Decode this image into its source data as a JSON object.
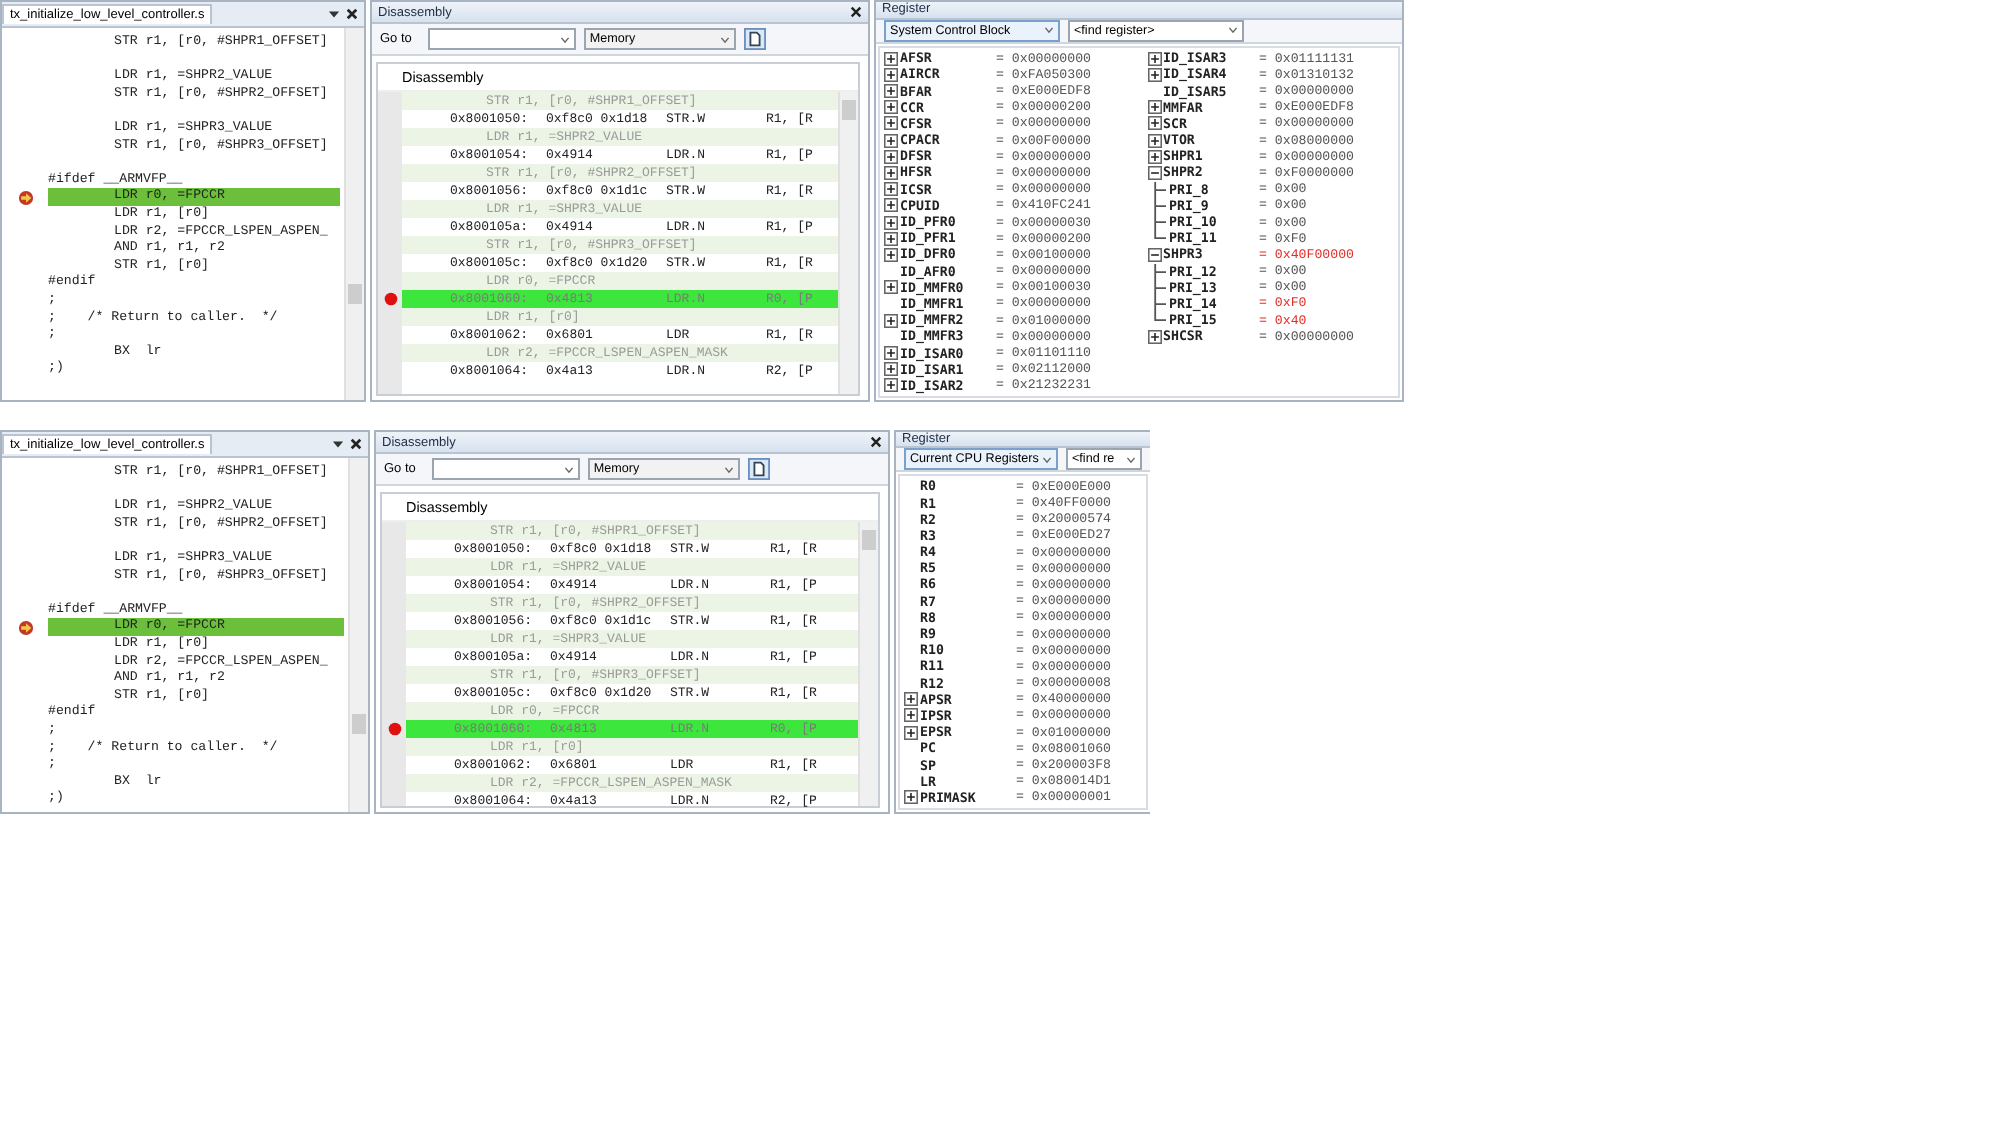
{
  "snapshots": [
    {
      "editor": {
        "tab": "tx_initialize_low_level_controller.s",
        "lines": [
          {
            "kind": "code",
            "indent": true,
            "text": "STR r1, [r0, #SHPR1_OFFSET]",
            "current": false
          },
          {
            "kind": "blank"
          },
          {
            "kind": "code",
            "indent": true,
            "text": "LDR r1, =SHPR2_VALUE",
            "current": false
          },
          {
            "kind": "code",
            "indent": true,
            "text": "STR r1, [r0, #SHPR2_OFFSET]",
            "current": false
          },
          {
            "kind": "blank"
          },
          {
            "kind": "code",
            "indent": true,
            "text": "LDR r1, =SHPR3_VALUE",
            "current": false
          },
          {
            "kind": "code",
            "indent": true,
            "text": "STR r1, [r0, #SHPR3_OFFSET]",
            "current": false
          },
          {
            "kind": "blank"
          },
          {
            "kind": "code",
            "indent": false,
            "text": "#ifdef __ARMVFP__",
            "current": false
          },
          {
            "kind": "code",
            "indent": true,
            "text": "LDR r0, =FPCCR",
            "current": true
          },
          {
            "kind": "code",
            "indent": true,
            "text": "LDR r1, [r0]",
            "current": false
          },
          {
            "kind": "code",
            "indent": true,
            "text": "LDR r2, =FPCCR_LSPEN_ASPEN_",
            "current": false
          },
          {
            "kind": "code",
            "indent": true,
            "text": "AND r1, r1, r2",
            "current": false
          },
          {
            "kind": "code",
            "indent": true,
            "text": "STR r1, [r0]",
            "current": false
          },
          {
            "kind": "code",
            "indent": false,
            "text": "#endif",
            "current": false
          },
          {
            "kind": "code",
            "indent": false,
            "text": ";",
            "current": false
          },
          {
            "kind": "code",
            "indent": false,
            "text": ";    /* Return to caller.  */",
            "current": false
          },
          {
            "kind": "code",
            "indent": false,
            "text": ";",
            "current": false
          },
          {
            "kind": "code",
            "indent": true,
            "text": "BX  lr",
            "current": false
          },
          {
            "kind": "code",
            "indent": false,
            "text": ";)",
            "current": false
          }
        ]
      },
      "disassembly": {
        "title": "Disassembly",
        "goto_label": "Go to",
        "memory": "Memory",
        "header": "Disassembly",
        "rows": [
          {
            "kind": "source",
            "text": "STR r1, [r0, #SHPR1_OFFSET]"
          },
          {
            "kind": "instr",
            "address": "0x8001050:",
            "opcode": "0xf8c0 0x1d18",
            "mnemonic": "STR.W",
            "operand": "R1, [R",
            "breakpoint": false,
            "current": false
          },
          {
            "kind": "source",
            "text": "LDR r1, =SHPR2_VALUE"
          },
          {
            "kind": "instr",
            "address": "0x8001054:",
            "opcode": "0x4914",
            "mnemonic": "LDR.N",
            "operand": "R1, [P",
            "breakpoint": false,
            "current": false
          },
          {
            "kind": "source",
            "text": "STR r1, [r0, #SHPR2_OFFSET]"
          },
          {
            "kind": "instr",
            "address": "0x8001056:",
            "opcode": "0xf8c0 0x1d1c",
            "mnemonic": "STR.W",
            "operand": "R1, [R",
            "breakpoint": false,
            "current": false
          },
          {
            "kind": "source",
            "text": "LDR r1, =SHPR3_VALUE"
          },
          {
            "kind": "instr",
            "address": "0x800105a:",
            "opcode": "0x4914",
            "mnemonic": "LDR.N",
            "operand": "R1, [P",
            "breakpoint": false,
            "current": false
          },
          {
            "kind": "source",
            "text": "STR r1, [r0, #SHPR3_OFFSET]"
          },
          {
            "kind": "instr",
            "address": "0x800105c:",
            "opcode": "0xf8c0 0x1d20",
            "mnemonic": "STR.W",
            "operand": "R1, [R",
            "breakpoint": false,
            "current": false
          },
          {
            "kind": "source",
            "text": "LDR r0, =FPCCR"
          },
          {
            "kind": "instr",
            "address": "0x8001060:",
            "opcode": "0x4813",
            "mnemonic": "LDR.N",
            "operand": "R0, [P",
            "breakpoint": true,
            "current": true
          },
          {
            "kind": "source",
            "text": "LDR r1, [r0]"
          },
          {
            "kind": "instr",
            "address": "0x8001062:",
            "opcode": "0x6801",
            "mnemonic": "LDR",
            "operand": "R1, [R",
            "breakpoint": false,
            "current": false
          },
          {
            "kind": "source",
            "text": "LDR r2, =FPCCR_LSPEN_ASPEN_MASK"
          },
          {
            "kind": "instr",
            "address": "0x8001064:",
            "opcode": "0x4a13",
            "mnemonic": "LDR.N",
            "operand": "R2, [P",
            "breakpoint": false,
            "current": false
          }
        ]
      },
      "register": {
        "title": "Register",
        "group": "System Control Block",
        "find": "<find register>",
        "columns": [
          {
            "registers": [
              {
                "name": "AFSR",
                "value": "= 0x00000000",
                "expandable": true,
                "expanded": false,
                "changed": false
              },
              {
                "name": "AIRCR",
                "value": "= 0xFA050300",
                "expandable": true,
                "expanded": false,
                "changed": false
              },
              {
                "name": "BFAR",
                "value": "= 0xE000EDF8",
                "expandable": true,
                "expanded": false,
                "changed": false
              },
              {
                "name": "CCR",
                "value": "= 0x00000200",
                "expandable": true,
                "expanded": false,
                "changed": false
              },
              {
                "name": "CFSR",
                "value": "= 0x00000000",
                "expandable": true,
                "expanded": false,
                "changed": false
              },
              {
                "name": "CPACR",
                "value": "= 0x00F00000",
                "expandable": true,
                "expanded": false,
                "changed": false
              },
              {
                "name": "DFSR",
                "value": "= 0x00000000",
                "expandable": true,
                "expanded": false,
                "changed": false
              },
              {
                "name": "HFSR",
                "value": "= 0x00000000",
                "expandable": true,
                "expanded": false,
                "changed": false
              },
              {
                "name": "ICSR",
                "value": "= 0x00000000",
                "expandable": true,
                "expanded": false,
                "changed": false
              },
              {
                "name": "CPUID",
                "value": "= 0x410FC241",
                "expandable": true,
                "expanded": false,
                "changed": false
              },
              {
                "name": "ID_PFR0",
                "value": "= 0x00000030",
                "expandable": true,
                "expanded": false,
                "changed": false
              },
              {
                "name": "ID_PFR1",
                "value": "= 0x00000200",
                "expandable": true,
                "expanded": false,
                "changed": false
              },
              {
                "name": "ID_DFR0",
                "value": "= 0x00100000",
                "expandable": true,
                "expanded": false,
                "changed": false
              },
              {
                "name": "ID_AFR0",
                "value": "= 0x00000000",
                "expandable": false,
                "changed": false
              },
              {
                "name": "ID_MMFR0",
                "value": "= 0x00100030",
                "expandable": true,
                "expanded": false,
                "changed": false
              },
              {
                "name": "ID_MMFR1",
                "value": "= 0x00000000",
                "expandable": false,
                "changed": false
              },
              {
                "name": "ID_MMFR2",
                "value": "= 0x01000000",
                "expandable": true,
                "expanded": false,
                "changed": false
              },
              {
                "name": "ID_MMFR3",
                "value": "= 0x00000000",
                "expandable": false,
                "changed": false
              },
              {
                "name": "ID_ISAR0",
                "value": "= 0x01101110",
                "expandable": true,
                "expanded": false,
                "changed": false
              },
              {
                "name": "ID_ISAR1",
                "value": "= 0x02112000",
                "expandable": true,
                "expanded": false,
                "changed": false
              },
              {
                "name": "ID_ISAR2",
                "value": "= 0x21232231",
                "expandable": true,
                "expanded": false,
                "changed": false
              }
            ]
          },
          {
            "registers": [
              {
                "name": "ID_ISAR3",
                "value": "= 0x01111131",
                "expandable": true,
                "expanded": false,
                "changed": false
              },
              {
                "name": "ID_ISAR4",
                "value": "= 0x01310132",
                "expandable": true,
                "expanded": false,
                "changed": false
              },
              {
                "name": "ID_ISAR5",
                "value": "= 0x00000000",
                "expandable": false,
                "changed": false
              },
              {
                "name": "MMFAR",
                "value": "= 0xE000EDF8",
                "expandable": true,
                "expanded": false,
                "changed": false
              },
              {
                "name": "SCR",
                "value": "= 0x00000000",
                "expandable": true,
                "expanded": false,
                "changed": false
              },
              {
                "name": "VTOR",
                "value": "= 0x08000000",
                "expandable": true,
                "expanded": false,
                "changed": false
              },
              {
                "name": "SHPR1",
                "value": "= 0x00000000",
                "expandable": true,
                "expanded": false,
                "changed": false
              },
              {
                "name": "SHPR2",
                "value": "= 0xF0000000",
                "expandable": true,
                "expanded": true,
                "changed": false,
                "children": [
                  {
                    "name": "PRI_8",
                    "value": "= 0x00",
                    "changed": false
                  },
                  {
                    "name": "PRI_9",
                    "value": "= 0x00",
                    "changed": false
                  },
                  {
                    "name": "PRI_10",
                    "value": "= 0x00",
                    "changed": false
                  },
                  {
                    "name": "PRI_11",
                    "value": "= 0xF0",
                    "changed": false
                  }
                ]
              },
              {
                "name": "SHPR3",
                "value": "= 0x40F00000",
                "expandable": true,
                "expanded": true,
                "changed": true,
                "children": [
                  {
                    "name": "PRI_12",
                    "value": "= 0x00",
                    "changed": false
                  },
                  {
                    "name": "PRI_13",
                    "value": "= 0x00",
                    "changed": false
                  },
                  {
                    "name": "PRI_14",
                    "value": "= 0xF0",
                    "changed": true
                  },
                  {
                    "name": "PRI_15",
                    "value": "= 0x40",
                    "changed": true
                  }
                ]
              },
              {
                "name": "SHCSR",
                "value": "= 0x00000000",
                "expandable": true,
                "expanded": false,
                "changed": false
              }
            ]
          }
        ]
      }
    },
    {
      "editor": {
        "tab": "tx_initialize_low_level_controller.s",
        "lines": [
          {
            "kind": "code",
            "indent": true,
            "text": "STR r1, [r0, #SHPR1_OFFSET]",
            "current": false
          },
          {
            "kind": "blank"
          },
          {
            "kind": "code",
            "indent": true,
            "text": "LDR r1, =SHPR2_VALUE",
            "current": false
          },
          {
            "kind": "code",
            "indent": true,
            "text": "STR r1, [r0, #SHPR2_OFFSET]",
            "current": false
          },
          {
            "kind": "blank"
          },
          {
            "kind": "code",
            "indent": true,
            "text": "LDR r1, =SHPR3_VALUE",
            "current": false
          },
          {
            "kind": "code",
            "indent": true,
            "text": "STR r1, [r0, #SHPR3_OFFSET]",
            "current": false
          },
          {
            "kind": "blank"
          },
          {
            "kind": "code",
            "indent": false,
            "text": "#ifdef __ARMVFP__",
            "current": false
          },
          {
            "kind": "code",
            "indent": true,
            "text": "LDR r0, =FPCCR",
            "current": true
          },
          {
            "kind": "code",
            "indent": true,
            "text": "LDR r1, [r0]",
            "current": false
          },
          {
            "kind": "code",
            "indent": true,
            "text": "LDR r2, =FPCCR_LSPEN_ASPEN_",
            "current": false
          },
          {
            "kind": "code",
            "indent": true,
            "text": "AND r1, r1, r2",
            "current": false
          },
          {
            "kind": "code",
            "indent": true,
            "text": "STR r1, [r0]",
            "current": false
          },
          {
            "kind": "code",
            "indent": false,
            "text": "#endif",
            "current": false
          },
          {
            "kind": "code",
            "indent": false,
            "text": ";",
            "current": false
          },
          {
            "kind": "code",
            "indent": false,
            "text": ";    /* Return to caller.  */",
            "current": false
          },
          {
            "kind": "code",
            "indent": false,
            "text": ";",
            "current": false
          },
          {
            "kind": "code",
            "indent": true,
            "text": "BX  lr",
            "current": false
          },
          {
            "kind": "code",
            "indent": false,
            "text": ";)",
            "current": false
          }
        ]
      },
      "disassembly": {
        "title": "Disassembly",
        "goto_label": "Go to",
        "memory": "Memory",
        "header": "Disassembly",
        "rows": [
          {
            "kind": "source",
            "text": "STR r1, [r0, #SHPR1_OFFSET]"
          },
          {
            "kind": "instr",
            "address": "0x8001050:",
            "opcode": "0xf8c0 0x1d18",
            "mnemonic": "STR.W",
            "operand": "R1, [R",
            "breakpoint": false,
            "current": false
          },
          {
            "kind": "source",
            "text": "LDR r1, =SHPR2_VALUE"
          },
          {
            "kind": "instr",
            "address": "0x8001054:",
            "opcode": "0x4914",
            "mnemonic": "LDR.N",
            "operand": "R1, [P",
            "breakpoint": false,
            "current": false
          },
          {
            "kind": "source",
            "text": "STR r1, [r0, #SHPR2_OFFSET]"
          },
          {
            "kind": "instr",
            "address": "0x8001056:",
            "opcode": "0xf8c0 0x1d1c",
            "mnemonic": "STR.W",
            "operand": "R1, [R",
            "breakpoint": false,
            "current": false
          },
          {
            "kind": "source",
            "text": "LDR r1, =SHPR3_VALUE"
          },
          {
            "kind": "instr",
            "address": "0x800105a:",
            "opcode": "0x4914",
            "mnemonic": "LDR.N",
            "operand": "R1, [P",
            "breakpoint": false,
            "current": false
          },
          {
            "kind": "source",
            "text": "STR r1, [r0, #SHPR3_OFFSET]"
          },
          {
            "kind": "instr",
            "address": "0x800105c:",
            "opcode": "0xf8c0 0x1d20",
            "mnemonic": "STR.W",
            "operand": "R1, [R",
            "breakpoint": false,
            "current": false
          },
          {
            "kind": "source",
            "text": "LDR r0, =FPCCR"
          },
          {
            "kind": "instr",
            "address": "0x8001060:",
            "opcode": "0x4813",
            "mnemonic": "LDR.N",
            "operand": "R0, [P",
            "breakpoint": true,
            "current": true
          },
          {
            "kind": "source",
            "text": "LDR r1, [r0]"
          },
          {
            "kind": "instr",
            "address": "0x8001062:",
            "opcode": "0x6801",
            "mnemonic": "LDR",
            "operand": "R1, [R",
            "breakpoint": false,
            "current": false
          },
          {
            "kind": "source",
            "text": "LDR r2, =FPCCR_LSPEN_ASPEN_MASK"
          },
          {
            "kind": "instr",
            "address": "0x8001064:",
            "opcode": "0x4a13",
            "mnemonic": "LDR.N",
            "operand": "R2, [P",
            "breakpoint": false,
            "current": false
          }
        ]
      },
      "register": {
        "title": "Register",
        "group": "Current CPU Registers",
        "find": "<find re",
        "columns": [
          {
            "registers": [
              {
                "name": "R0",
                "value": "= 0xE000E000",
                "expandable": false,
                "changed": false
              },
              {
                "name": "R1",
                "value": "= 0x40FF0000",
                "expandable": false,
                "changed": false
              },
              {
                "name": "R2",
                "value": "= 0x20000574",
                "expandable": false,
                "changed": false
              },
              {
                "name": "R3",
                "value": "= 0xE000ED27",
                "expandable": false,
                "changed": false
              },
              {
                "name": "R4",
                "value": "= 0x00000000",
                "expandable": false,
                "changed": false
              },
              {
                "name": "R5",
                "value": "= 0x00000000",
                "expandable": false,
                "changed": false
              },
              {
                "name": "R6",
                "value": "= 0x00000000",
                "expandable": false,
                "changed": false
              },
              {
                "name": "R7",
                "value": "= 0x00000000",
                "expandable": false,
                "changed": false
              },
              {
                "name": "R8",
                "value": "= 0x00000000",
                "expandable": false,
                "changed": false
              },
              {
                "name": "R9",
                "value": "= 0x00000000",
                "expandable": false,
                "changed": false
              },
              {
                "name": "R10",
                "value": "= 0x00000000",
                "expandable": false,
                "changed": false
              },
              {
                "name": "R11",
                "value": "= 0x00000000",
                "expandable": false,
                "changed": false
              },
              {
                "name": "R12",
                "value": "= 0x00000008",
                "expandable": false,
                "changed": false
              },
              {
                "name": "APSR",
                "value": "= 0x40000000",
                "expandable": true,
                "expanded": false,
                "changed": false
              },
              {
                "name": "IPSR",
                "value": "= 0x00000000",
                "expandable": true,
                "expanded": false,
                "changed": false
              },
              {
                "name": "EPSR",
                "value": "= 0x01000000",
                "expandable": true,
                "expanded": false,
                "changed": false
              },
              {
                "name": "PC",
                "value": "= 0x08001060",
                "expandable": false,
                "changed": false
              },
              {
                "name": "SP",
                "value": "= 0x200003F8",
                "expandable": false,
                "changed": false
              },
              {
                "name": "LR",
                "value": "= 0x080014D1",
                "expandable": false,
                "changed": false
              },
              {
                "name": "PRIMASK",
                "value": "= 0x00000001",
                "expandable": true,
                "expanded": false,
                "changed": false
              }
            ]
          }
        ]
      }
    }
  ]
}
